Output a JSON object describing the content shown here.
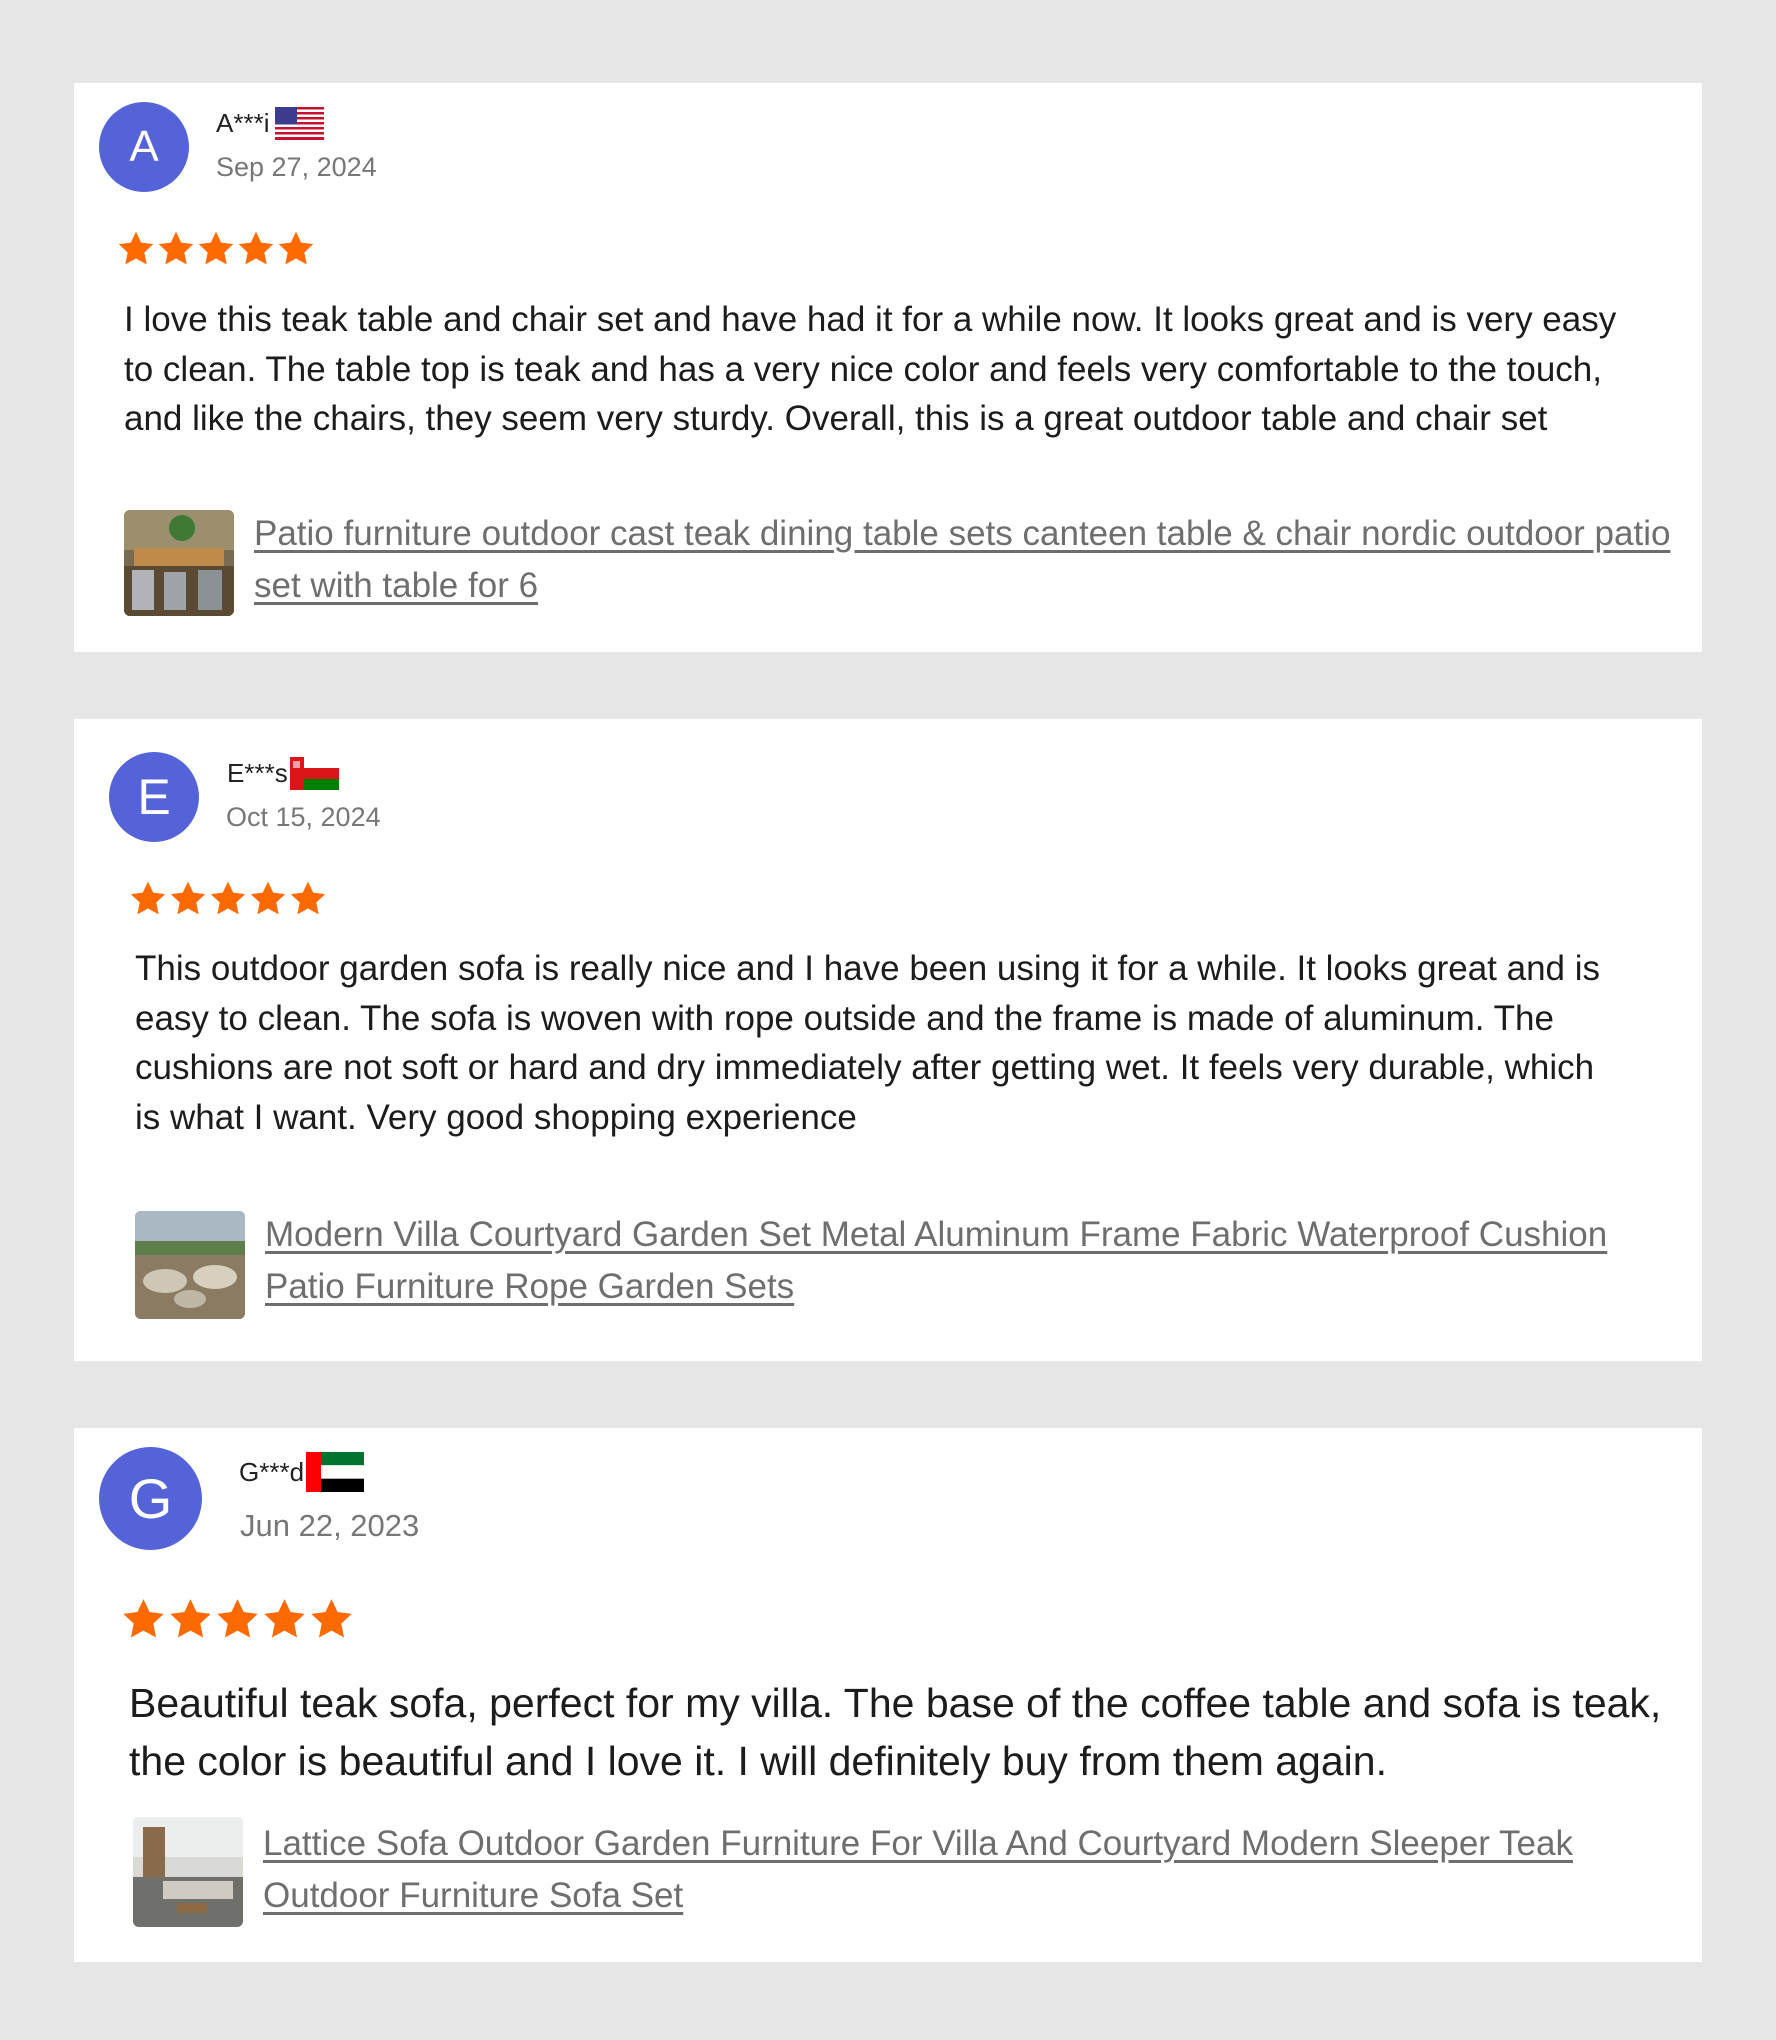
{
  "colors": {
    "page_bg": "#e6e6e6",
    "card_bg": "#ffffff",
    "avatar_bg": "#5563d8",
    "star": "#ff6a00",
    "link": "#6e6e6e",
    "date": "#777777"
  },
  "reviews": [
    {
      "avatar_letter": "A",
      "name": "A***i",
      "flag_icon": "us-flag-icon",
      "date": "Sep 27, 2024",
      "rating": 5,
      "text": "I love this teak table and chair set and have had it for a while now. It looks great and is very easy to clean. The table top is teak and has a very nice color and feels very comfortable to the touch, and like the chairs, they seem very sturdy. Overall, this is a great outdoor table and chair set",
      "product_link": "Patio furniture outdoor cast teak dining table sets canteen table & chair nordic outdoor patio set with table for 6"
    },
    {
      "avatar_letter": "E",
      "name": "E***s",
      "flag_icon": "oman-flag-icon",
      "date": "Oct 15, 2024",
      "rating": 5,
      "text": "This outdoor garden sofa is really nice and I have been using it for a while. It looks great and is easy to clean. The sofa is woven with rope outside and the frame is made of aluminum. The cushions are not soft or hard and dry immediately after getting wet. It feels very durable, which is what I want. Very good shopping experience",
      "product_link": "Modern Villa Courtyard Garden Set Metal Aluminum Frame Fabric Waterproof Cushion Patio Furniture Rope Garden Sets"
    },
    {
      "avatar_letter": "G",
      "name": "G***d",
      "flag_icon": "uae-flag-icon",
      "date": "Jun 22, 2023",
      "rating": 5,
      "text": "Beautiful teak sofa, perfect for my villa. The base of the coffee table and sofa is teak, the color is beautiful and I love it. I will definitely buy from them again.",
      "product_link": "Lattice Sofa Outdoor Garden Furniture For Villa And Courtyard Modern Sleeper Teak Outdoor Furniture Sofa Set"
    }
  ]
}
